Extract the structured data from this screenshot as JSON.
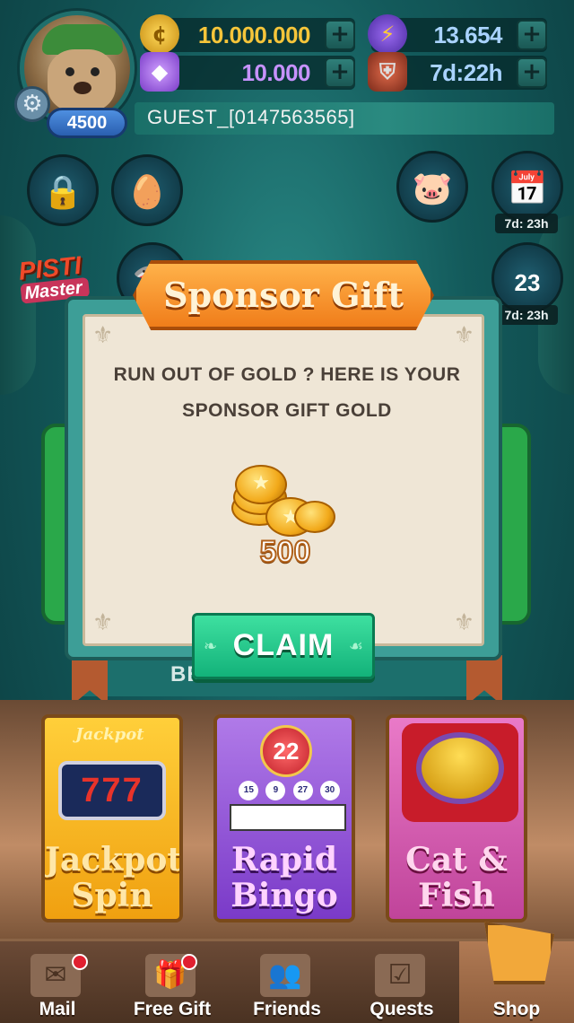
{
  "player": {
    "level": "4500",
    "name": "GUEST_[0147563565]"
  },
  "currencies": {
    "gold": {
      "value": "10.000.000",
      "icon": "gold-coin-icon"
    },
    "gems": {
      "value": "10.000",
      "icon": "gem-icon"
    },
    "energy": {
      "value": "13.654",
      "icon": "lightning-icon"
    },
    "shield": {
      "value": "7d:22h",
      "icon": "shield-icon"
    },
    "plus_label": "+"
  },
  "side": {
    "calendar_timer": "7d: 23h",
    "trophy_timer": "7d: 23h",
    "trophy_rank": "23",
    "pisti_title": "PISTI",
    "pisti_subtitle": "Master"
  },
  "background": {
    "bet_label": "BET GOLD 500"
  },
  "dialog": {
    "title": "Sponsor Gift",
    "message_line1": "RUN OUT OF GOLD ? HERE IS YOUR",
    "message_line2": "SPONSOR GIFT GOLD",
    "reward_amount": "500",
    "claim_label": "CLAIM"
  },
  "games": [
    {
      "id": "jackpot-spin",
      "line1": "Jackpot",
      "line2": "Spin",
      "art_label": "Jackpot",
      "art_value": "777"
    },
    {
      "id": "rapid-bingo",
      "line1": "Rapid",
      "line2": "Bingo",
      "ball": "22",
      "numbers": [
        "15",
        "9",
        "27",
        "30"
      ]
    },
    {
      "id": "cat-fish",
      "line1": "Cat &",
      "line2": "Fish"
    }
  ],
  "nav": [
    {
      "id": "mail",
      "label": "Mail",
      "icon": "mail-icon",
      "badge": true
    },
    {
      "id": "free-gift",
      "label": "Free Gift",
      "icon": "gift-icon",
      "badge": true
    },
    {
      "id": "friends",
      "label": "Friends",
      "icon": "friends-icon",
      "badge": false
    },
    {
      "id": "quests",
      "label": "Quests",
      "icon": "checkbox-icon",
      "badge": false
    },
    {
      "id": "shop",
      "label": "Shop",
      "icon": "cart-icon",
      "badge": false
    }
  ],
  "colors": {
    "gold_text": "#f5c53a",
    "gem_text": "#c792ff",
    "claim_green": "#13b27a",
    "banner_orange": "#f07d1a"
  }
}
